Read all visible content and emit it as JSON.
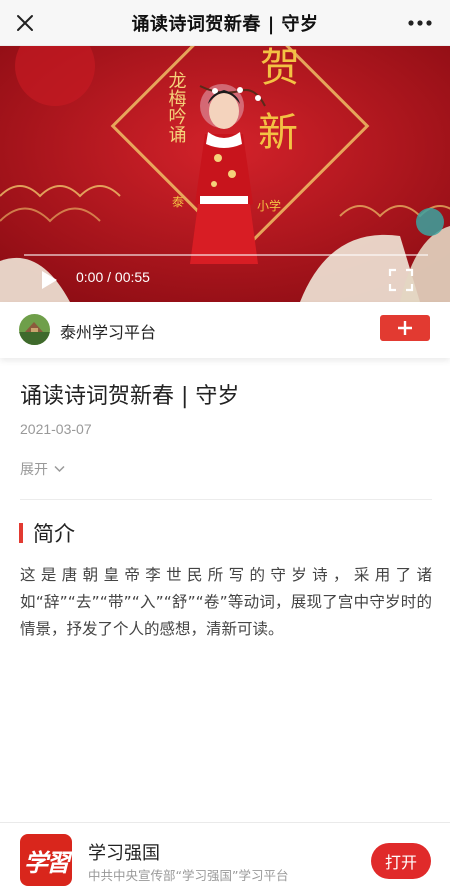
{
  "header": {
    "title": "诵读诗词贺新春 | 守岁"
  },
  "video": {
    "time": "0:00 / 00:55",
    "progress_fraction": 0,
    "scene_text": {
      "vertical": "龙梅吟诵",
      "big1": "贺",
      "big2": "新",
      "school_left": "泰",
      "school_right": "小学"
    }
  },
  "channel": {
    "name": "泰州学习平台",
    "follow_icon": "plus-icon"
  },
  "article": {
    "title": "诵读诗词贺新春 | 守岁",
    "date": "2021-03-07",
    "expand_label": "展开"
  },
  "section": {
    "heading": "简介",
    "text": "这是唐朝皇帝李世民所写的守岁诗，采用了诸如“辞”“去”“带”“入”“舒”“卷”等动词，展现了宫中守岁时的情景，抒发了个人的感想，清新可读。"
  },
  "bottom_bar": {
    "logo_text": "学習",
    "app_name": "学习强国",
    "app_sub": "中共中央宣传部“学习强国”学习平台",
    "open_label": "打开"
  },
  "colors": {
    "accent": "#e23a31",
    "open_button": "#e02a2a",
    "video_bg": "#b3121c"
  }
}
